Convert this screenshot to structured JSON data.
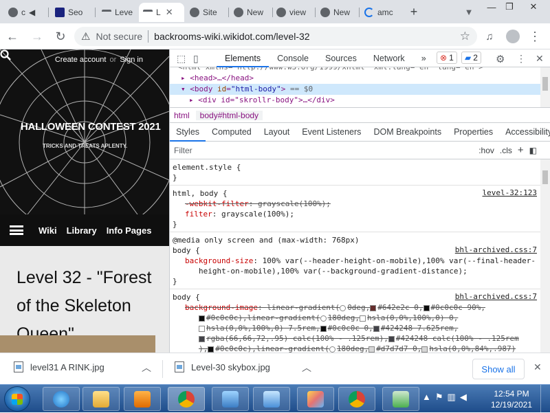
{
  "browser": {
    "tabs": [
      {
        "title": "c",
        "icon": "chrome-icon"
      },
      {
        "title": "Seo",
        "icon": "site-icon"
      },
      {
        "title": "Leve",
        "icon": "batwing-icon"
      },
      {
        "title": "L",
        "icon": "batwing-icon"
      },
      {
        "title": "Site",
        "icon": "chrome-icon"
      },
      {
        "title": "New",
        "icon": "chrome-icon"
      },
      {
        "title": "view",
        "icon": "chrome-icon"
      },
      {
        "title": "New",
        "icon": "chrome-icon"
      },
      {
        "title": "amc",
        "icon": "loading-icon"
      }
    ],
    "new_tab": "+",
    "not_secure": "Not secure",
    "url": "backrooms-wiki.wikidot.com/level-32"
  },
  "site": {
    "create_account": "Create account",
    "or": "or",
    "sign_in": "Sign in",
    "contest_title": "HALLOWEEN CONTEST 2021",
    "contest_subtitle": "TRICKS AND TREATS APLENTY.",
    "nav": [
      "Wiki",
      "Library",
      "Info Pages"
    ],
    "page_title": "Level 32 - \"Forest of the Skeleton Queen\""
  },
  "devtools": {
    "tabs": [
      "Elements",
      "Console",
      "Sources",
      "Network"
    ],
    "more": "»",
    "errors": "1",
    "messages": "2",
    "dom": {
      "line0": "<html xmlns=\"http://www.w3.org/1999/xhtml\" xml:lang=\"en\" lang=\"en\">",
      "line1": "<head>…</head>",
      "body_tag": "<body",
      "body_attr": "id",
      "body_val": "\"html-body\"",
      "body_end": ">",
      "body_eq": "== $0",
      "line3": "<div id=\"skrollr-body\">…</div>"
    },
    "crumbs": [
      "html",
      "body#html-body"
    ],
    "subtabs": [
      "Styles",
      "Computed",
      "Layout",
      "Event Listeners",
      "DOM Breakpoints",
      "Properties",
      "Accessibility"
    ],
    "filter_placeholder": "Filter",
    "hov": ":hov",
    "cls": ".cls",
    "plus": "+",
    "rules": {
      "r1_sel": "element.style {",
      "r1_close": "}",
      "r2_sel": "html, body {",
      "r2_src": "level-32:123",
      "r2_p1_name": "-webkit-filter",
      "r2_p1_val": "grayscale(100%);",
      "r2_p2_name": "filter",
      "r2_p2_val": "grayscale(100%);",
      "r2_close": "}",
      "r3_media": "@media only screen and (max-width: 768px)",
      "r3_sel": "body {",
      "r3_src": "bhl-archived.css:7",
      "r3_name": "background-size",
      "r3_val1": "100% var(--header-height-on-mobile),100% var(--final-header-",
      "r3_val2": "height-on-mobile),100% var(--background-gradient-distance);",
      "r3_close": "}",
      "r4_sel": "body {",
      "r4_src": "bhl-archived.css:7",
      "r4_name": "background-image",
      "r4_l1": "linear-gradient(",
      "r4_l1b": "0deg,",
      "r4_l1c": "#642e2c 0,",
      "r4_l1d": "#0c0c0c 90%,",
      "r4_l2a": "#0c0c0c),linear-gradient(",
      "r4_l2b": "180deg,",
      "r4_l2c": "hsla(0,0%,100%,0) 0,",
      "r4_l3a": "hsla(0,0%,100%,0) 7.5rem,",
      "r4_l3b": "#0c0c0c 0,",
      "r4_l3c": "#424248 7.625rem,",
      "r4_l4a": "rgba(66,66,72,.95) calc(100% - .125rem),",
      "r4_l4b": "#424248 calc(100% - .125rem",
      "r4_l5a": "),",
      "r4_l5b": "#0c0c0c),linear-gradient(",
      "r4_l5c": "180deg,",
      "r4_l5d": "#d7d7d7 0,",
      "r4_l5e": "hsla(0,0%,84%,.987)"
    },
    "colors": {
      "c642e2c": "#642e2c",
      "c0c0c0c": "#0c0c0c",
      "white": "#ffffff",
      "c424248": "#424248",
      "cd7d7d7": "#d7d7d7"
    }
  },
  "downloads": {
    "items": [
      "level31 A RINK.jpg",
      "Level-30 skybox.jpg"
    ],
    "show_all": "Show all",
    "close": "✕"
  },
  "taskbar": {
    "time": "12:54 PM",
    "date": "12/19/2021"
  }
}
